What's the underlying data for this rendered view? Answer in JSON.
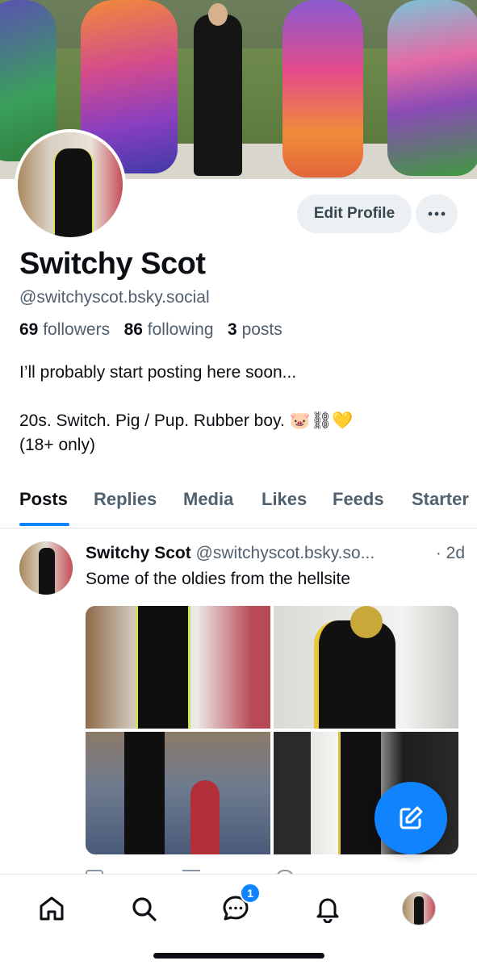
{
  "profile": {
    "edit_label": "Edit Profile",
    "more_icon": "ellipsis-icon",
    "display_name": "Switchy Scot",
    "handle": "@switchyscot.bsky.social",
    "followers_count": "69",
    "followers_label": "followers",
    "following_count": "86",
    "following_label": "following",
    "posts_count": "3",
    "posts_label": "posts",
    "bio_line1": "I’ll probably start posting here soon...",
    "bio_line2": "20s. Switch. Pig / Pup. Rubber boy. 🐷⛓💛",
    "bio_line3": "(18+ only)"
  },
  "tabs": [
    {
      "label": "Posts",
      "active": true
    },
    {
      "label": "Replies"
    },
    {
      "label": "Media"
    },
    {
      "label": "Likes"
    },
    {
      "label": "Feeds"
    },
    {
      "label": "Starter"
    }
  ],
  "post": {
    "author": "Switchy Scot",
    "handle": "@switchyscot.bsky.so...",
    "time": "· 2d",
    "text": "Some of the oldies from the hellsite"
  },
  "nav": {
    "items": [
      "home-icon",
      "search-icon",
      "chat-icon",
      "bell-icon",
      "profile-avatar"
    ],
    "chat_badge": "1"
  },
  "colors": {
    "accent": "#1083fe",
    "muted_text": "#51606e",
    "button_bg": "#edf0f3"
  }
}
